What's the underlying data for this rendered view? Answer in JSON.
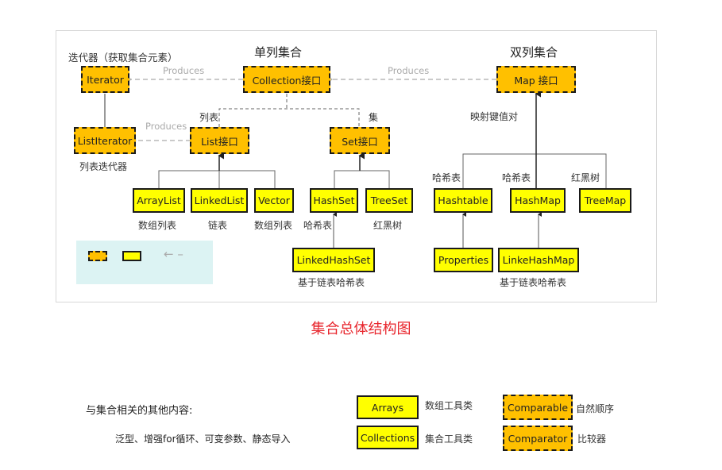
{
  "headers": {
    "single_column": "单列集合",
    "double_column": "双列集合",
    "iterator_caption": "迭代器（获取集合元素）"
  },
  "relation_labels": {
    "produces_1": "Produces",
    "produces_2": "Produces",
    "produces_3": "Produces"
  },
  "nodes": {
    "iterator": "Iterator",
    "collection": "Collection接口",
    "map": "Map 接口",
    "list_iterator": "ListIterator",
    "list": "List接口",
    "set": "Set接口",
    "arraylist": "ArrayList",
    "linkedlist": "LinkedList",
    "vector": "Vector",
    "hashset": "HashSet",
    "treeset": "TreeSet",
    "linkedhashset": "LinkedHashSet",
    "hashtable": "Hashtable",
    "hashmap": "HashMap",
    "treemap": "TreeMap",
    "properties": "Properties",
    "linkehashmap": "LinkeHashMap"
  },
  "labels": {
    "list_branch": "列表",
    "set_branch": "集",
    "list_iterator_desc": "列表迭代器",
    "map_desc": "映射键值对",
    "arraylist_desc": "数组列表",
    "linkedlist_desc": "链表",
    "vector_desc": "数组列表",
    "hashset_desc": "哈希表",
    "treeset_desc": "红黑树",
    "linkedhashset_desc": "基于链表哈希表",
    "hashtable_desc": "哈希表",
    "hashmap_desc": "哈希表",
    "treemap_desc": "红黑树",
    "linkehashmap_desc": "基于链表哈希表"
  },
  "legend": {
    "arrow_symbol": "← –"
  },
  "title": "集合总体结构图",
  "other": {
    "heading": "与集合相关的其他内容:",
    "items": "泛型、增强for循环、可变参数、静态导入",
    "arrays": "Arrays",
    "arrays_desc": "数组工具类",
    "collections": "Collections",
    "collections_desc": "集合工具类",
    "comparable": "Comparable",
    "comparable_desc": "自然顺序",
    "comparator": "Comparator",
    "comparator_desc": "比较器"
  },
  "colors": {
    "interface_fill": "#ffc000",
    "class_fill": "#ffff00",
    "title_red": "#e8262d",
    "legend_bg": "#dcf3f3"
  }
}
